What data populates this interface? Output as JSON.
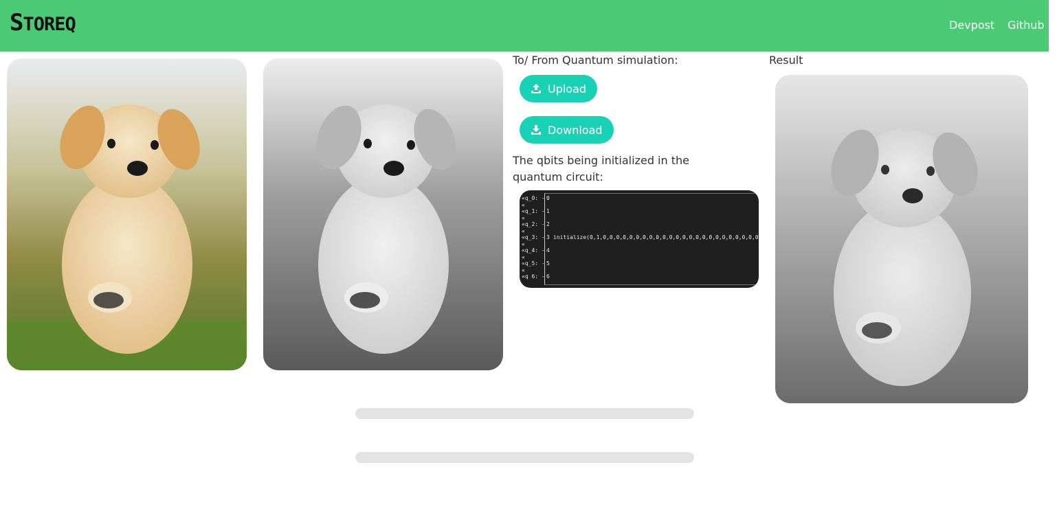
{
  "navbar": {
    "brand_first": "S",
    "brand_rest": "TOREQ",
    "links": [
      "Devpost",
      "Github"
    ]
  },
  "images": {
    "original": "puppy-color-photo",
    "grayscale": "puppy-grayscale-photo",
    "result": "puppy-grayscale-result-photo"
  },
  "simulation": {
    "label": "To/ From Quantum simulation:",
    "upload_label": "Upload",
    "download_label": "Download",
    "circuit_label": "The qbits being initialized in the quantum circuit:"
  },
  "circuit": {
    "wires": [
      "«q_0: -",
      "«",
      "«q_1: -",
      "«",
      "«q_2: -",
      "«",
      "«q_3: -",
      "«",
      "«q_4: -",
      "«",
      "«q_5: -",
      "«",
      "«q 6: -"
    ],
    "wire_numbers": [
      "0",
      "1",
      "2",
      "3",
      "4",
      "5",
      "6"
    ],
    "gate_text": "initialize(0,1,0,0,0,0,0,0,0,0,0,0,0,0,0,0,0,0,0,0,0,0,0,0,0,0"
  },
  "result": {
    "label": "Result"
  },
  "colors": {
    "navbar": "#4bc974",
    "button": "#19d1b5",
    "terminal_bg": "#1f1f1f",
    "progress_track": "#e3e3e3"
  },
  "progress_bars": [
    {
      "value": 0
    },
    {
      "value": 0
    }
  ]
}
